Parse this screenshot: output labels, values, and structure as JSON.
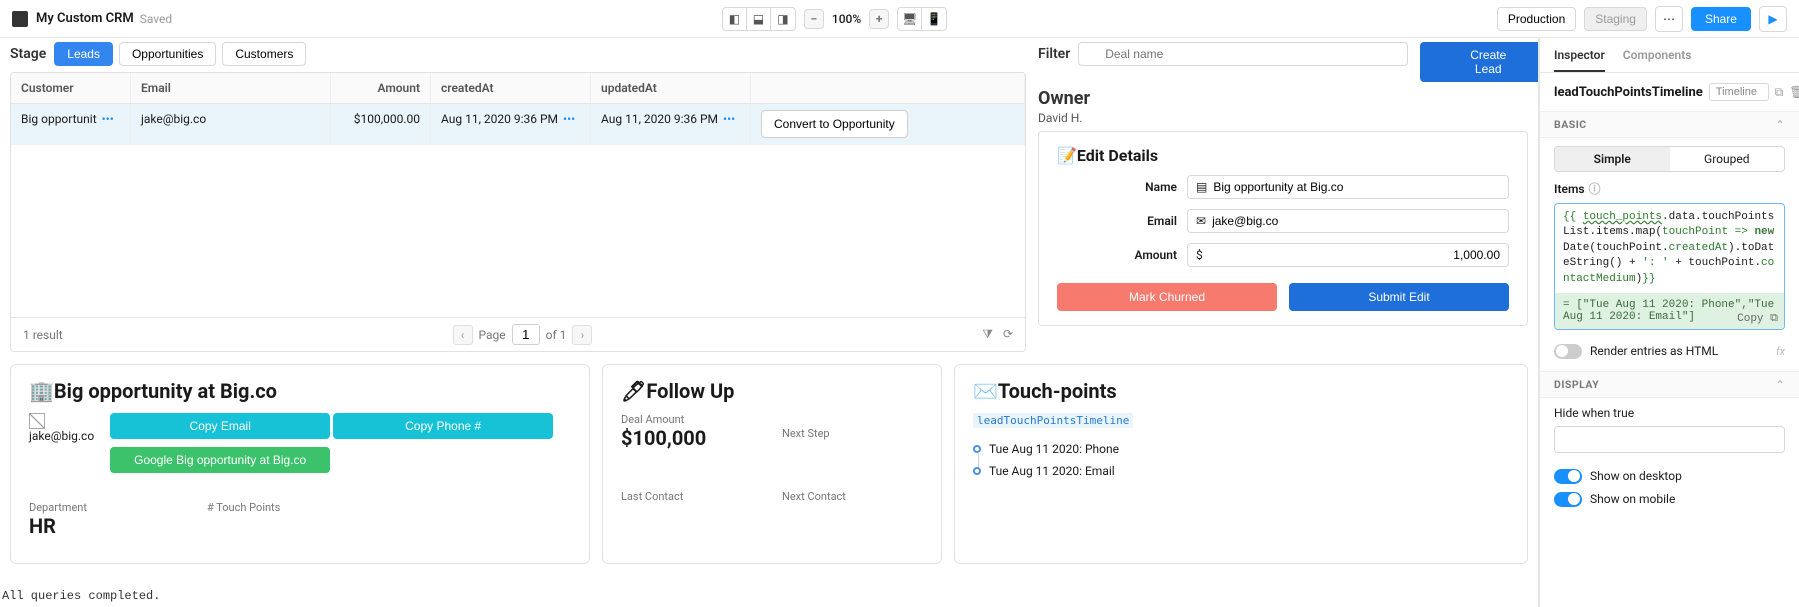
{
  "topbar": {
    "title": "My Custom CRM",
    "saved": "Saved",
    "zoom": "100%",
    "env_production": "Production",
    "env_staging": "Staging",
    "share": "Share"
  },
  "stage": {
    "label": "Stage",
    "tabs": [
      "Leads",
      "Opportunities",
      "Customers"
    ],
    "active": 0
  },
  "filter": {
    "label": "Filter",
    "placeholder": "Deal name",
    "create_btn": "Create Lead"
  },
  "grid": {
    "headers": [
      "Customer",
      "Email",
      "Amount",
      "createdAt",
      "updatedAt"
    ],
    "rows": [
      {
        "customer": "Big opportunit",
        "email": "jake@big.co",
        "amount": "$100,000.00",
        "createdAt": "Aug 11, 2020 9:36 PM",
        "updatedAt": "Aug 11, 2020 9:36 PM"
      }
    ],
    "convert_btn": "Convert to Opportunity",
    "result_count": "1 result",
    "page_label": "Page",
    "page_current": "1",
    "page_of": "of 1"
  },
  "owner": {
    "title": "Owner",
    "name": "David H."
  },
  "edit": {
    "title": "Edit Details",
    "name_label": "Name",
    "name_value": "Big opportunity at Big.co",
    "email_label": "Email",
    "email_value": "jake@big.co",
    "amount_label": "Amount",
    "amount_prefix": "$",
    "amount_value": "1,000.00",
    "churn_btn": "Mark Churned",
    "submit_btn": "Submit Edit"
  },
  "lead_card": {
    "title": "Big opportunity at Big.co",
    "email": "jake@big.co",
    "copy_email": "Copy Email",
    "copy_phone": "Copy Phone #",
    "google_btn": "Google Big opportunity at Big.co",
    "dept_label": "Department",
    "dept_value": "HR",
    "touch_label": "# Touch Points"
  },
  "followup": {
    "title": "Follow Up",
    "deal_amount_label": "Deal Amount",
    "deal_amount_value": "$100,000",
    "next_step_label": "Next Step",
    "last_contact_label": "Last Contact",
    "next_contact_label": "Next Contact"
  },
  "touchpoints": {
    "title": "Touch-points",
    "component": "leadTouchPointsTimeline",
    "items": [
      "Tue Aug 11 2020: Phone",
      "Tue Aug 11 2020: Email"
    ]
  },
  "inspector": {
    "tabs": [
      "Inspector",
      "Components"
    ],
    "component_name": "leadTouchPointsTimeline",
    "type_value": "Timeline",
    "section_basic": "BASIC",
    "simple": "Simple",
    "grouped": "Grouped",
    "items_label": "Items",
    "code_tokens": [
      {
        "t": "{{ ",
        "c": "kw"
      },
      {
        "t": "touch_points",
        "c": "und kw"
      },
      {
        "t": ".data.touchPointsList.items.map(",
        "c": ""
      },
      {
        "t": "touchPoint",
        "c": "kw"
      },
      {
        "t": " => ",
        "c": "kw"
      },
      {
        "t": "new",
        "c": "new"
      },
      {
        "t": " Date(touchPoint.",
        "c": ""
      },
      {
        "t": "createdAt",
        "c": "kw"
      },
      {
        "t": ").toDateString() + ",
        "c": ""
      },
      {
        "t": "': '",
        "c": "str"
      },
      {
        "t": " + touchPoint.",
        "c": ""
      },
      {
        "t": "contactMedium",
        "c": "kw"
      },
      {
        "t": ")",
        "c": ""
      },
      {
        "t": "}}",
        "c": "kw"
      }
    ],
    "result": "= [\"Tue Aug 11 2020: Phone\",\"Tue Aug 11 2020: Email\"]",
    "copy": "Copy",
    "render_html": "Render entries as HTML",
    "section_display": "DISPLAY",
    "hide_label": "Hide when true",
    "show_desktop": "Show on desktop",
    "show_mobile": "Show on mobile"
  },
  "status": "All queries completed."
}
